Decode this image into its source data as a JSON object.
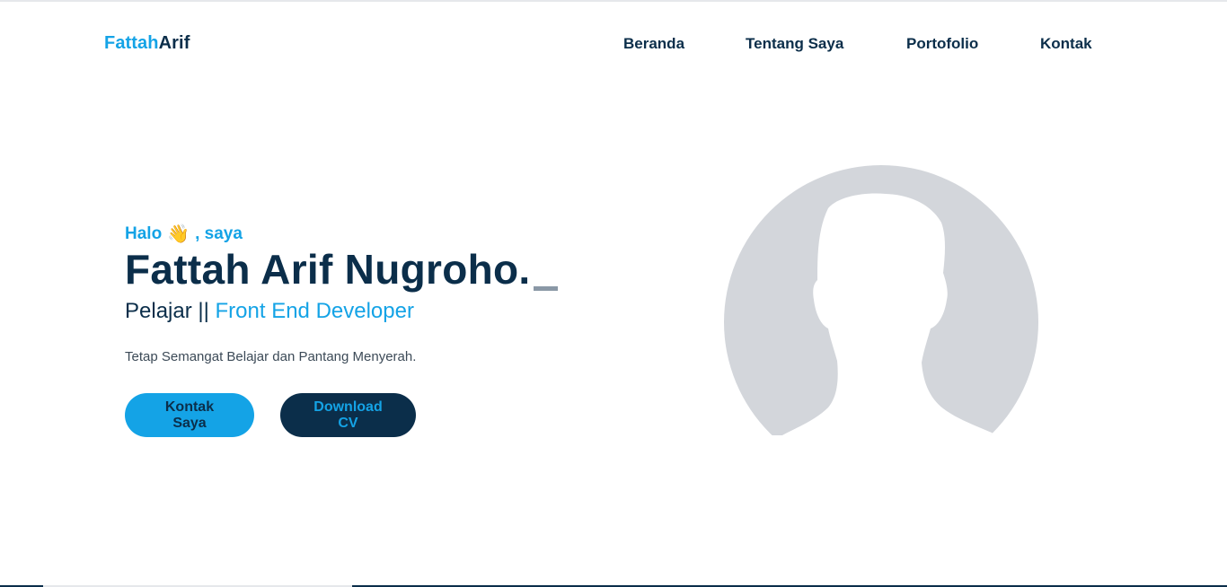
{
  "logo": {
    "first": "Fattah",
    "last": "Arif"
  },
  "nav": {
    "items": [
      {
        "label": "Beranda"
      },
      {
        "label": "Tentang Saya"
      },
      {
        "label": "Portofolio"
      },
      {
        "label": "Kontak"
      }
    ]
  },
  "hero": {
    "greeting_start": "Halo",
    "greeting_emoji": "👋",
    "greeting_end": ", saya",
    "name": "Fattah Arif Nugroho.",
    "role_prefix": "Pelajar || ",
    "role_highlight": "Front End Developer",
    "tagline": "Tetap Semangat Belajar dan Pantang Menyerah.",
    "primary_button": "Kontak Saya",
    "secondary_button": "Download CV"
  },
  "avatar": {
    "icon": "person-silhouette-icon"
  },
  "colors": {
    "accent": "#14a3e6",
    "navy": "#0b2e4a",
    "avatar_bg": "#d3d6db",
    "silhouette": "#ffffff"
  }
}
